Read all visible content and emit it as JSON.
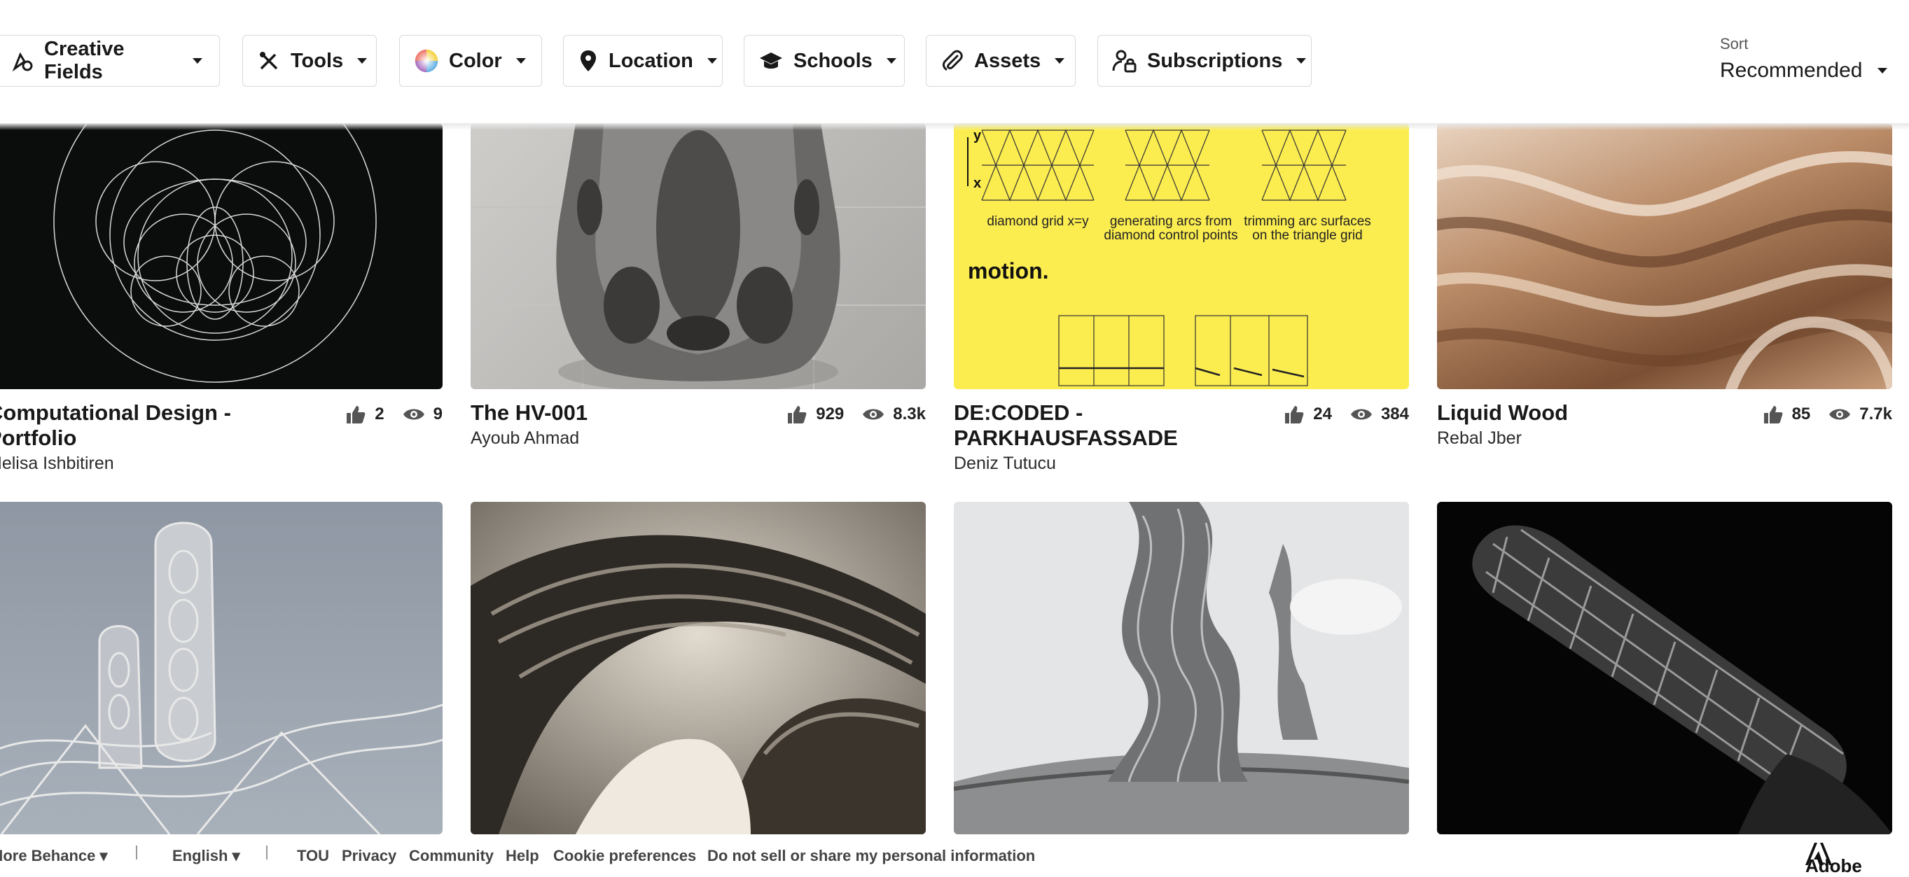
{
  "filters": {
    "creative_fields": "Creative Fields",
    "tools": "Tools",
    "color": "Color",
    "location": "Location",
    "schools": "Schools",
    "assets": "Assets",
    "subscriptions": "Subscriptions"
  },
  "sort": {
    "label": "Sort",
    "value": "Recommended"
  },
  "projects": [
    {
      "title": "Computational Design - Portfolio",
      "owner": "Melisa Ishbitiren",
      "likes": "2",
      "views": "9"
    },
    {
      "title": "The HV-001",
      "owner": "Ayoub Ahmad",
      "likes": "929",
      "views": "8.3k"
    },
    {
      "title": "DE:CODED - PARKHAUSFASSADE",
      "owner": "Deniz Tutucu",
      "likes": "24",
      "views": "384"
    },
    {
      "title": "Liquid Wood",
      "owner": "Rebal Jber",
      "likes": "85",
      "views": "7.7k"
    }
  ],
  "thumb_text": {
    "axis_y": "y",
    "axis_x": "x",
    "caption1": "diamond grid x=y",
    "caption2a": "generating arcs from",
    "caption2b": "diamond control points",
    "caption3a": "trimming arc surfaces",
    "caption3b": "on the triangle grid",
    "heading": "motion."
  },
  "footer": {
    "more": "More Behance",
    "language": "English",
    "tou": "TOU",
    "privacy": "Privacy",
    "community": "Community",
    "help": "Help",
    "cookies": "Cookie preferences",
    "dnss": "Do not sell or share my personal information",
    "brand": "Adobe"
  },
  "colors": {
    "accent_yellow": "#fbec50",
    "text": "#191919",
    "border": "#d9d9d9"
  }
}
